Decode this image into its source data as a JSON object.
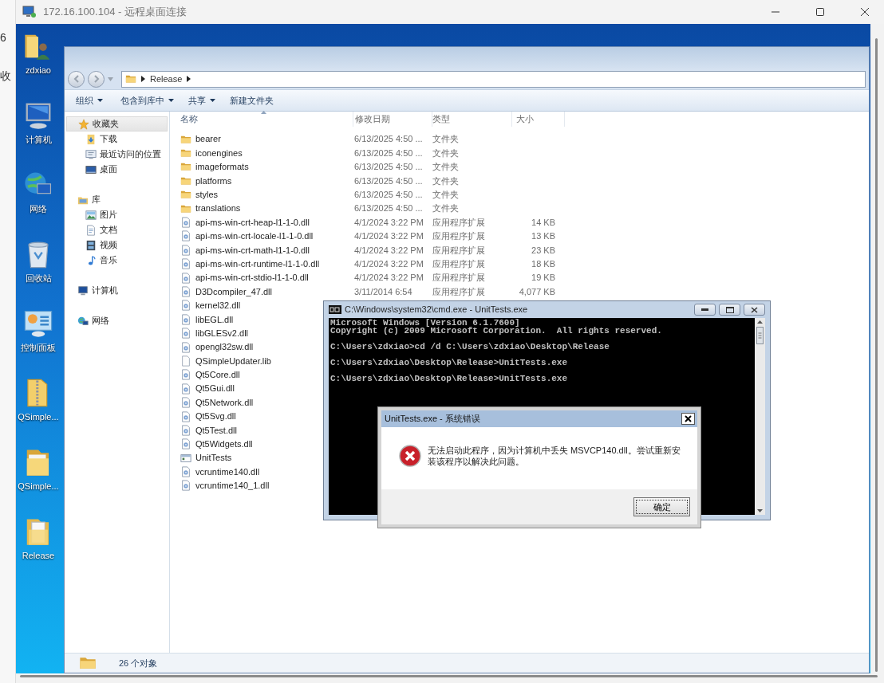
{
  "background_fragments": [
    "6",
    "收"
  ],
  "window": {
    "title": "172.16.100.104 - 远程桌面连接"
  },
  "desktop_icons": [
    {
      "label": "zdxiao",
      "kind": "user-folder"
    },
    {
      "label": "计算机",
      "kind": "computer"
    },
    {
      "label": "网络",
      "kind": "network"
    },
    {
      "label": "回收站",
      "kind": "recycle-bin"
    },
    {
      "label": "控制面板",
      "kind": "control-panel"
    },
    {
      "label": "QSimple...",
      "kind": "zip-folder"
    },
    {
      "label": "QSimple...",
      "kind": "folder"
    },
    {
      "label": "Release",
      "kind": "docs-folder"
    }
  ],
  "explorer": {
    "breadcrumb": [
      "Release"
    ],
    "toolbar": [
      {
        "label": "组织",
        "dropdown": true
      },
      {
        "label": "包含到库中",
        "dropdown": true
      },
      {
        "label": "共享",
        "dropdown": true
      },
      {
        "label": "新建文件夹",
        "dropdown": false
      }
    ],
    "nav": [
      {
        "label": "收藏夹",
        "kind": "favorites",
        "selected": true,
        "children": [
          {
            "label": "下载",
            "kind": "downloads",
            "selected": false
          },
          {
            "label": "最近访问的位置",
            "kind": "recent",
            "selected": false
          },
          {
            "label": "桌面",
            "kind": "desktop",
            "selected": false
          }
        ]
      },
      {
        "label": "库",
        "kind": "libraries",
        "selected": false,
        "children": [
          {
            "label": "图片",
            "kind": "pictures",
            "selected": false
          },
          {
            "label": "文档",
            "kind": "documents",
            "selected": false
          },
          {
            "label": "视频",
            "kind": "videos",
            "selected": false
          },
          {
            "label": "音乐",
            "kind": "music",
            "selected": false
          }
        ]
      },
      {
        "label": "计算机",
        "kind": "computer",
        "selected": false
      },
      {
        "label": "网络",
        "kind": "network",
        "selected": false
      }
    ],
    "columns": [
      "名称",
      "修改日期",
      "类型",
      "大小"
    ],
    "rows": [
      {
        "name": "bearer",
        "kind": "folder",
        "modified": "6/13/2025 4:50 ...",
        "type": "文件夹"
      },
      {
        "name": "iconengines",
        "kind": "folder",
        "modified": "6/13/2025 4:50 ...",
        "type": "文件夹"
      },
      {
        "name": "imageformats",
        "kind": "folder",
        "modified": "6/13/2025 4:50 ...",
        "type": "文件夹"
      },
      {
        "name": "platforms",
        "kind": "folder",
        "modified": "6/13/2025 4:50 ...",
        "type": "文件夹"
      },
      {
        "name": "styles",
        "kind": "folder",
        "modified": "6/13/2025 4:50 ...",
        "type": "文件夹"
      },
      {
        "name": "translations",
        "kind": "folder",
        "modified": "6/13/2025 4:50 ...",
        "type": "文件夹"
      },
      {
        "name": "api-ms-win-crt-heap-l1-1-0.dll",
        "kind": "dll",
        "modified": "4/1/2024 3:22 PM",
        "type": "应用程序扩展",
        "size": "14 KB"
      },
      {
        "name": "api-ms-win-crt-locale-l1-1-0.dll",
        "kind": "dll",
        "modified": "4/1/2024 3:22 PM",
        "type": "应用程序扩展",
        "size": "13 KB"
      },
      {
        "name": "api-ms-win-crt-math-l1-1-0.dll",
        "kind": "dll",
        "modified": "4/1/2024 3:22 PM",
        "type": "应用程序扩展",
        "size": "23 KB"
      },
      {
        "name": "api-ms-win-crt-runtime-l1-1-0.dll",
        "kind": "dll",
        "modified": "4/1/2024 3:22 PM",
        "type": "应用程序扩展",
        "size": "18 KB"
      },
      {
        "name": "api-ms-win-crt-stdio-l1-1-0.dll",
        "kind": "dll",
        "modified": "4/1/2024 3:22 PM",
        "type": "应用程序扩展",
        "size": "19 KB"
      },
      {
        "name": "D3Dcompiler_47.dll",
        "kind": "dll",
        "modified": "3/11/2014 6:54",
        "type": "应用程序扩展",
        "size": "4,077 KB"
      },
      {
        "name": "kernel32.dll",
        "kind": "dll"
      },
      {
        "name": "libEGL.dll",
        "kind": "dll"
      },
      {
        "name": "libGLESv2.dll",
        "kind": "dll"
      },
      {
        "name": "opengl32sw.dll",
        "kind": "dll"
      },
      {
        "name": "QSimpleUpdater.lib",
        "kind": "lib"
      },
      {
        "name": "Qt5Core.dll",
        "kind": "dll"
      },
      {
        "name": "Qt5Gui.dll",
        "kind": "dll"
      },
      {
        "name": "Qt5Network.dll",
        "kind": "dll"
      },
      {
        "name": "Qt5Svg.dll",
        "kind": "dll"
      },
      {
        "name": "Qt5Test.dll",
        "kind": "dll"
      },
      {
        "name": "Qt5Widgets.dll",
        "kind": "dll"
      },
      {
        "name": "UnitTests",
        "kind": "exe"
      },
      {
        "name": "vcruntime140.dll",
        "kind": "dll"
      },
      {
        "name": "vcruntime140_1.dll",
        "kind": "dll"
      }
    ],
    "status": "26 个对象"
  },
  "cmd": {
    "title": "C:\\Windows\\system32\\cmd.exe - UnitTests.exe",
    "blocks": [
      [
        "Microsoft Windows [Version 6.1.7600]",
        "Copyright (c) 2009 Microsoft Corporation.  All rights reserved."
      ],
      [
        "C:\\Users\\zdxiao>cd /d C:\\Users\\zdxiao\\Desktop\\Release"
      ],
      [
        "C:\\Users\\zdxiao\\Desktop\\Release>UnitTests.exe"
      ],
      [
        "C:\\Users\\zdxiao\\Desktop\\Release>UnitTests.exe"
      ]
    ]
  },
  "dialog": {
    "title": "UnitTests.exe - 系统错误",
    "message": "无法启动此程序，因为计算机中丢失 MSVCP140.dll。尝试重新安装该程序以解决此问题。",
    "button": "确定"
  }
}
